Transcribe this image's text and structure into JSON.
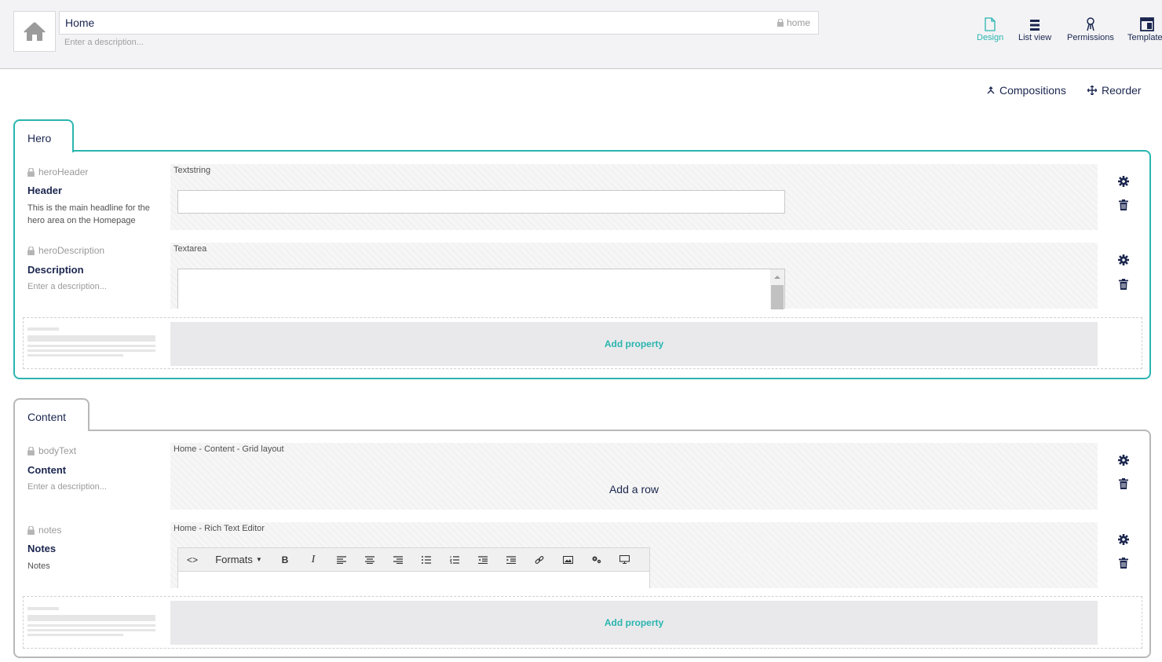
{
  "header": {
    "name": "Home",
    "alias": "home",
    "description_placeholder": "Enter a description...",
    "apps": [
      {
        "label": "Design",
        "icon": "document-icon",
        "active": true
      },
      {
        "label": "List view",
        "icon": "list-view-icon",
        "active": false
      },
      {
        "label": "Permissions",
        "icon": "permissions-icon",
        "active": false
      },
      {
        "label": "Templates",
        "icon": "template-icon",
        "active": false
      }
    ]
  },
  "toolbar": {
    "compositions": "Compositions",
    "reorder": "Reorder"
  },
  "groups": [
    {
      "name": "Hero",
      "properties": [
        {
          "alias": "heroHeader",
          "label": "Header",
          "description": "This is the main headline for the hero area on the Homepage",
          "editor": "Textstring"
        },
        {
          "alias": "heroDescription",
          "label": "Description",
          "description": "Enter a description...",
          "editor": "Textarea"
        }
      ],
      "add_property": "Add property"
    },
    {
      "name": "Content",
      "properties": [
        {
          "alias": "bodyText",
          "label": "Content",
          "description": "Enter a description...",
          "editor": "Home - Content - Grid layout",
          "placeholder": "Add a row"
        },
        {
          "alias": "notes",
          "label": "Notes",
          "description": "Notes",
          "editor": "Home - Rich Text Editor"
        }
      ],
      "add_property": "Add property"
    }
  ],
  "rte": {
    "formats": "Formats"
  },
  "colors": {
    "accent": "#2bb5b0",
    "text": "#1b264f",
    "border": "#b8b8b8"
  }
}
